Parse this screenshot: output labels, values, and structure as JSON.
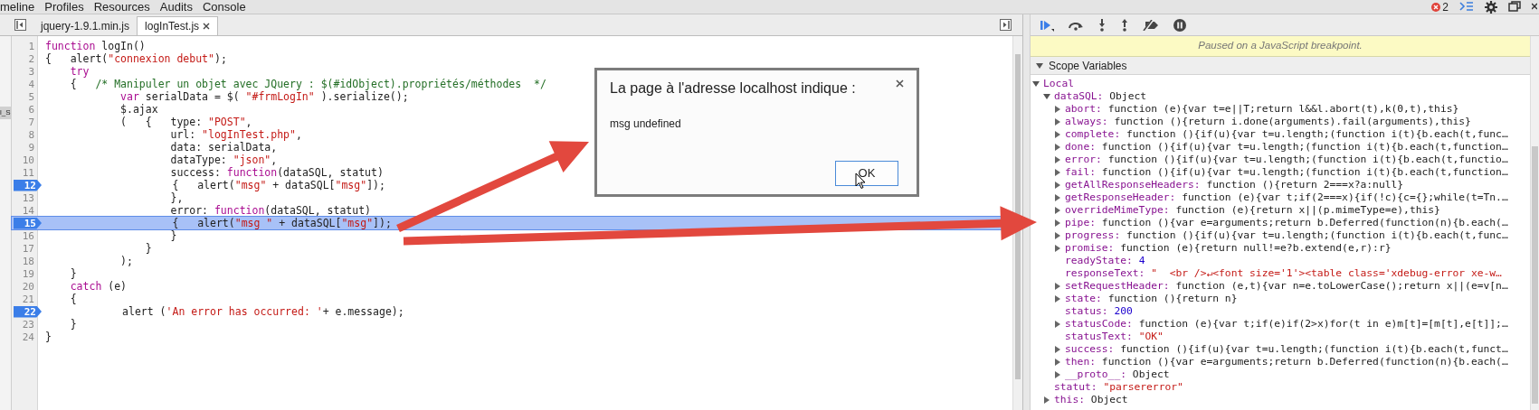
{
  "menu": {
    "items": [
      "meline",
      "Profiles",
      "Resources",
      "Audits",
      "Console"
    ],
    "error_count": "2"
  },
  "sidebar_fragment": "l_S",
  "tabs": [
    {
      "label": "jquery-1.9.1.min.js",
      "selected": false,
      "closable": false
    },
    {
      "label": "logInTest.js",
      "selected": true,
      "closable": true
    }
  ],
  "code": {
    "lines": [
      {
        "number": "1",
        "breakpoint": false,
        "current": false,
        "tokens": [
          {
            "kind": "keyword",
            "text": "function"
          },
          {
            "kind": "plain",
            "text": " logIn()"
          }
        ]
      },
      {
        "number": "2",
        "breakpoint": false,
        "current": false,
        "tokens": [
          {
            "kind": "plain",
            "text": "{   alert("
          },
          {
            "kind": "string",
            "text": "\"connexion debut\""
          },
          {
            "kind": "plain",
            "text": ");"
          }
        ]
      },
      {
        "number": "3",
        "breakpoint": false,
        "current": false,
        "tokens": [
          {
            "kind": "keyword",
            "text": "    try"
          }
        ]
      },
      {
        "number": "4",
        "breakpoint": false,
        "current": false,
        "tokens": [
          {
            "kind": "plain",
            "text": "    {   "
          },
          {
            "kind": "comment",
            "text": "/* Manipuler un objet avec JQuery : $(#idObject).propriétés/méthodes  */"
          }
        ]
      },
      {
        "number": "5",
        "breakpoint": false,
        "current": false,
        "tokens": [
          {
            "kind": "keyword",
            "text": "            var"
          },
          {
            "kind": "plain",
            "text": " serialData = $( "
          },
          {
            "kind": "string",
            "text": "\"#frmLogIn\""
          },
          {
            "kind": "plain",
            "text": " ).serialize();"
          }
        ]
      },
      {
        "number": "6",
        "breakpoint": false,
        "current": false,
        "tokens": [
          {
            "kind": "plain",
            "text": "            $.ajax"
          }
        ]
      },
      {
        "number": "7",
        "breakpoint": false,
        "current": false,
        "tokens": [
          {
            "kind": "plain",
            "text": "            (   {   type: "
          },
          {
            "kind": "string",
            "text": "\"POST\""
          },
          {
            "kind": "plain",
            "text": ","
          }
        ]
      },
      {
        "number": "8",
        "breakpoint": false,
        "current": false,
        "tokens": [
          {
            "kind": "plain",
            "text": "                    url: "
          },
          {
            "kind": "string",
            "text": "\"logInTest.php\""
          },
          {
            "kind": "plain",
            "text": ","
          }
        ]
      },
      {
        "number": "9",
        "breakpoint": false,
        "current": false,
        "tokens": [
          {
            "kind": "plain",
            "text": "                    data: serialData,"
          }
        ]
      },
      {
        "number": "10",
        "breakpoint": false,
        "current": false,
        "tokens": [
          {
            "kind": "plain",
            "text": "                    dataType: "
          },
          {
            "kind": "string",
            "text": "\"json\""
          },
          {
            "kind": "plain",
            "text": ","
          }
        ]
      },
      {
        "number": "11",
        "breakpoint": false,
        "current": false,
        "tokens": [
          {
            "kind": "plain",
            "text": "                    success: "
          },
          {
            "kind": "keyword",
            "text": "function"
          },
          {
            "kind": "plain",
            "text": "(dataSQL, statut)"
          }
        ]
      },
      {
        "number": "12",
        "breakpoint": true,
        "current": false,
        "tokens": [
          {
            "kind": "plain",
            "text": "                    {   alert("
          },
          {
            "kind": "string",
            "text": "\"msg\""
          },
          {
            "kind": "plain",
            "text": " + dataSQL["
          },
          {
            "kind": "string",
            "text": "\"msg\""
          },
          {
            "kind": "plain",
            "text": "]);"
          }
        ]
      },
      {
        "number": "13",
        "breakpoint": false,
        "current": false,
        "tokens": [
          {
            "kind": "plain",
            "text": "                    },"
          }
        ]
      },
      {
        "number": "14",
        "breakpoint": false,
        "current": false,
        "tokens": [
          {
            "kind": "plain",
            "text": "                    error: "
          },
          {
            "kind": "keyword",
            "text": "function"
          },
          {
            "kind": "plain",
            "text": "(dataSQL, statut)"
          }
        ]
      },
      {
        "number": "15",
        "breakpoint": true,
        "current": true,
        "tokens": [
          {
            "kind": "plain",
            "text": "                    {   alert("
          },
          {
            "kind": "string",
            "text": "\"msg \""
          },
          {
            "kind": "plain",
            "text": " + dataSQL["
          },
          {
            "kind": "string",
            "text": "\"msg\""
          },
          {
            "kind": "plain",
            "text": "]);"
          }
        ]
      },
      {
        "number": "16",
        "breakpoint": false,
        "current": false,
        "tokens": [
          {
            "kind": "plain",
            "text": "                    }"
          }
        ]
      },
      {
        "number": "17",
        "breakpoint": false,
        "current": false,
        "tokens": [
          {
            "kind": "plain",
            "text": "                }"
          }
        ]
      },
      {
        "number": "18",
        "breakpoint": false,
        "current": false,
        "tokens": [
          {
            "kind": "plain",
            "text": "            );"
          }
        ]
      },
      {
        "number": "19",
        "breakpoint": false,
        "current": false,
        "tokens": [
          {
            "kind": "plain",
            "text": "    }"
          }
        ]
      },
      {
        "number": "20",
        "breakpoint": false,
        "current": false,
        "tokens": [
          {
            "kind": "keyword",
            "text": "    catch"
          },
          {
            "kind": "plain",
            "text": " (e)"
          }
        ]
      },
      {
        "number": "21",
        "breakpoint": false,
        "current": false,
        "tokens": [
          {
            "kind": "plain",
            "text": "    {"
          }
        ]
      },
      {
        "number": "22",
        "breakpoint": true,
        "current": false,
        "tokens": [
          {
            "kind": "plain",
            "text": "            alert ("
          },
          {
            "kind": "string",
            "text": "'An error has occurred: '"
          },
          {
            "kind": "plain",
            "text": "+ e.message);"
          }
        ]
      },
      {
        "number": "23",
        "breakpoint": false,
        "current": false,
        "tokens": [
          {
            "kind": "plain",
            "text": "    }"
          }
        ]
      },
      {
        "number": "24",
        "breakpoint": false,
        "current": false,
        "tokens": [
          {
            "kind": "plain",
            "text": "}"
          }
        ]
      }
    ]
  },
  "dialog": {
    "title": "La page à l'adresse localhost indique :",
    "message": "msg undefined",
    "button": "OK"
  },
  "debugger": {
    "banner": "Paused on a JavaScript breakpoint.",
    "scope": {
      "title": "Scope Variables",
      "expanded": true,
      "groups": [
        {
          "name": "Local",
          "expanded": true,
          "children": [
            {
              "name": "dataSQL:",
              "value": "Object",
              "kind": "object",
              "expanded": true,
              "children": [
                {
                  "name": "abort:",
                  "value": "function (e){var t=e||T;return l&&l.abort(t),k(0,t),this}",
                  "kind": "function",
                  "expanded": false
                },
                {
                  "name": "always:",
                  "value": "function (){return i.done(arguments).fail(arguments),this}",
                  "kind": "function",
                  "expanded": false
                },
                {
                  "name": "complete:",
                  "value": "function (){if(u){var t=u.length;(function i(t){b.each(t,func…",
                  "kind": "function",
                  "expanded": false
                },
                {
                  "name": "done:",
                  "value": "function (){if(u){var t=u.length;(function i(t){b.each(t,function…",
                  "kind": "function",
                  "expanded": false
                },
                {
                  "name": "error:",
                  "value": "function (){if(u){var t=u.length;(function i(t){b.each(t,functio…",
                  "kind": "function",
                  "expanded": false
                },
                {
                  "name": "fail:",
                  "value": "function (){if(u){var t=u.length;(function i(t){b.each(t,function…",
                  "kind": "function",
                  "expanded": false
                },
                {
                  "name": "getAllResponseHeaders:",
                  "value": "function (){return 2===x?a:null}",
                  "kind": "function",
                  "expanded": false
                },
                {
                  "name": "getResponseHeader:",
                  "value": "function (e){var t;if(2===x){if(!c){c={};while(t=Tn.…",
                  "kind": "function",
                  "expanded": false
                },
                {
                  "name": "overrideMimeType:",
                  "value": "function (e){return x||(p.mimeType=e),this}",
                  "kind": "function",
                  "expanded": false
                },
                {
                  "name": "pipe:",
                  "value": "function (){var e=arguments;return b.Deferred(function(n){b.each(…",
                  "kind": "function",
                  "expanded": false
                },
                {
                  "name": "progress:",
                  "value": "function (){if(u){var t=u.length;(function i(t){b.each(t,func…",
                  "kind": "function",
                  "expanded": false
                },
                {
                  "name": "promise:",
                  "value": "function (e){return null!=e?b.extend(e,r):r}",
                  "kind": "function",
                  "expanded": false
                },
                {
                  "name": "readyState:",
                  "value": "4",
                  "kind": "number"
                },
                {
                  "name": "responseText:",
                  "value": "\"  <br />↵<font size='1'><table class='xdebug-error xe-w…",
                  "kind": "string"
                },
                {
                  "name": "setRequestHeader:",
                  "value": "function (e,t){var n=e.toLowerCase();return x||(e=v[n…",
                  "kind": "function",
                  "expanded": false
                },
                {
                  "name": "state:",
                  "value": "function (){return n}",
                  "kind": "function",
                  "expanded": false
                },
                {
                  "name": "status:",
                  "value": "200",
                  "kind": "number"
                },
                {
                  "name": "statusCode:",
                  "value": "function (e){var t;if(e)if(2>x)for(t in e)m[t]=[m[t],e[t]];…",
                  "kind": "function",
                  "expanded": false
                },
                {
                  "name": "statusText:",
                  "value": "\"OK\"",
                  "kind": "string"
                },
                {
                  "name": "success:",
                  "value": "function (){if(u){var t=u.length;(function i(t){b.each(t,funct…",
                  "kind": "function",
                  "expanded": false
                },
                {
                  "name": "then:",
                  "value": "function (){var e=arguments;return b.Deferred(function(n){b.each(…",
                  "kind": "function",
                  "expanded": false
                },
                {
                  "name": "__proto__:",
                  "value": "Object",
                  "kind": "object",
                  "expanded": false
                }
              ]
            },
            {
              "name": "statut:",
              "value": "\"parsererror\"",
              "kind": "string"
            },
            {
              "name": "this:",
              "value": "Object",
              "kind": "object",
              "expanded": false
            }
          ]
        }
      ]
    }
  }
}
